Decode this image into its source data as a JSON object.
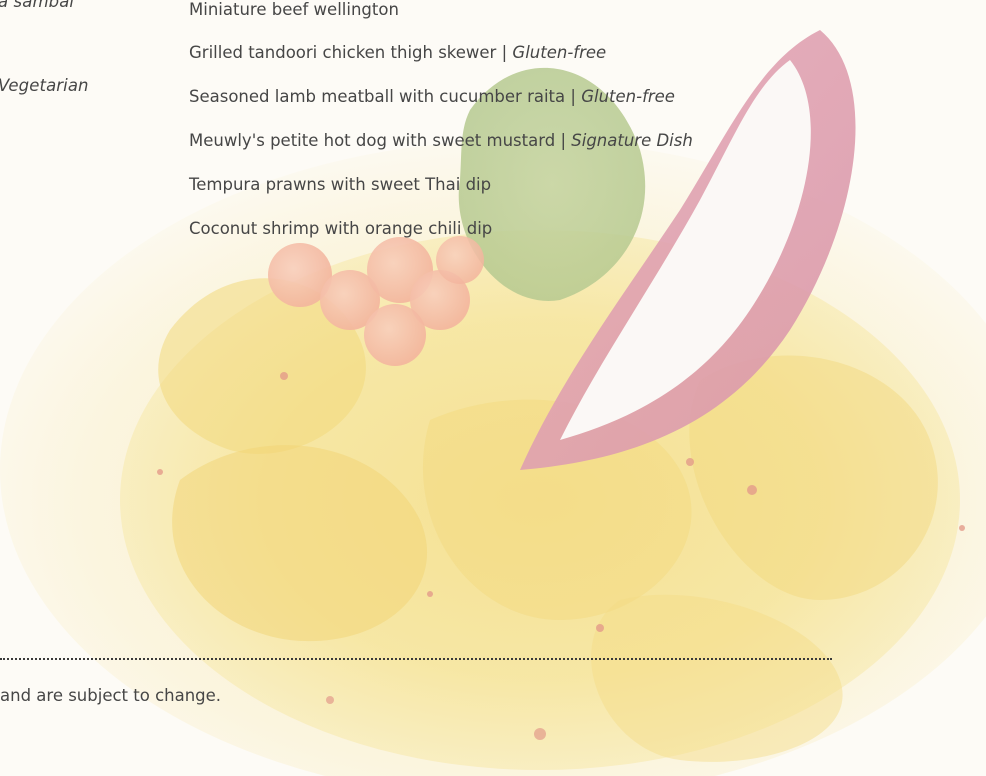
{
  "left_column": {
    "line1": "a sambal",
    "line2": "Vegetarian"
  },
  "menu_items": [
    {
      "name": "Miniature beef wellington",
      "separator": "",
      "note": ""
    },
    {
      "name": "Grilled tandoori chicken thigh skewer",
      "separator": " | ",
      "note": "Gluten-free"
    },
    {
      "name": "Seasoned lamb meatball with cucumber raita",
      "separator": " | ",
      "note": "Gluten-free"
    },
    {
      "name": "Meuwly's petite hot dog with sweet mustard",
      "separator": " | ",
      "note": "Signature Dish"
    },
    {
      "name": "Tempura prawns with sweet Thai dip",
      "separator": "",
      "note": ""
    },
    {
      "name": "Coconut shrimp with orange chili dip",
      "separator": "",
      "note": ""
    }
  ],
  "footnote": "and are subject to change."
}
